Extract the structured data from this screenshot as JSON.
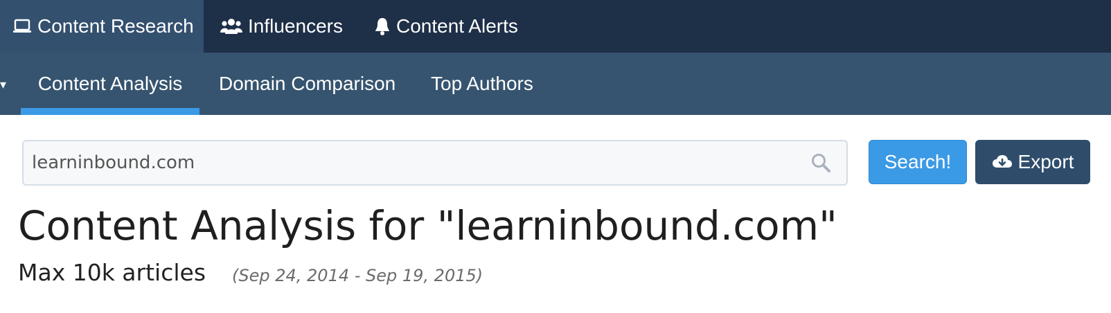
{
  "topnav": {
    "items": [
      {
        "label": "Content Research",
        "icon": "laptop-icon",
        "active": true
      },
      {
        "label": "Influencers",
        "icon": "users-icon",
        "active": false
      },
      {
        "label": "Content Alerts",
        "icon": "bell-icon",
        "active": false
      }
    ]
  },
  "subnav": {
    "items": [
      {
        "label": "Content Analysis",
        "active": true
      },
      {
        "label": "Domain Comparison",
        "active": false
      },
      {
        "label": "Top Authors",
        "active": false
      }
    ]
  },
  "search": {
    "value": "learninbound.com",
    "button_label": "Search!",
    "export_label": "Export"
  },
  "heading": {
    "title": "Content Analysis for \"learninbound.com\"",
    "subtitle": "Max 10k articles",
    "date_range": "(Sep 24, 2014 - Sep 19, 2015)"
  },
  "colors": {
    "topnav_bg": "#1e2f48",
    "topnav_active": "#34506f",
    "subnav_bg": "#36546f",
    "accent": "#3b9ae6",
    "export_bg": "#2f4d6b"
  }
}
